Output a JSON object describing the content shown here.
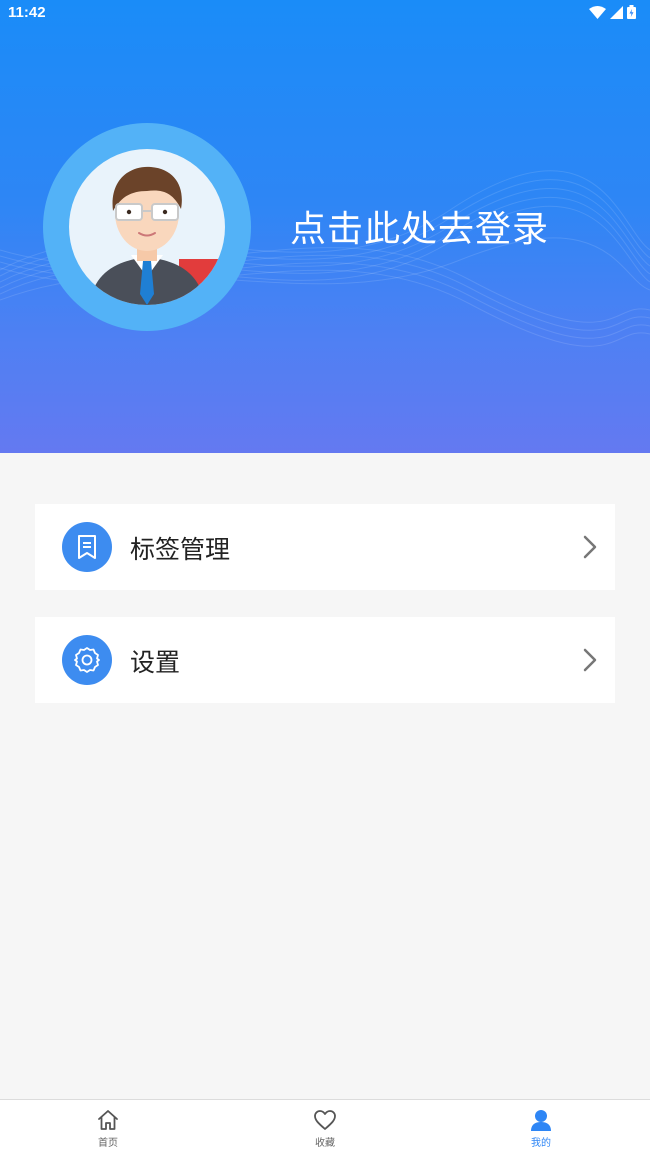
{
  "status_bar": {
    "time": "11:42"
  },
  "header": {
    "login_prompt": "点击此处去登录"
  },
  "menu": {
    "items": [
      {
        "label": "标签管理",
        "icon": "bookmark-icon"
      },
      {
        "label": "设置",
        "icon": "gear-icon"
      }
    ]
  },
  "tabbar": {
    "tabs": [
      {
        "label": "首页",
        "icon": "home-icon",
        "active": false
      },
      {
        "label": "收藏",
        "icon": "heart-icon",
        "active": false
      },
      {
        "label": "我的",
        "icon": "user-icon",
        "active": true
      }
    ]
  },
  "colors": {
    "accent": "#2e86f5",
    "header_top": "#1a8cf8",
    "header_bottom": "#6479f1"
  }
}
